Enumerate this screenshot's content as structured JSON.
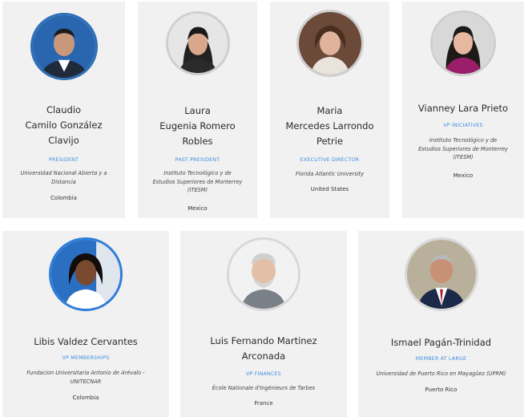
{
  "members": [
    {
      "name_lines": [
        "Claudio",
        "Camilo González",
        "Clavijo"
      ],
      "role": "PRESIDENT",
      "institution_lines": [
        "Universidad Nacional Abierta y a",
        "Distancia"
      ],
      "country": "Colombia"
    },
    {
      "name_lines": [
        "Laura",
        "Eugenia Romero",
        "Robles"
      ],
      "role": "PAST PRESIDENT",
      "institution_lines": [
        "Instituto Tecnológico y de",
        "Estudios Superiores de Monterrey",
        "(ITESM)"
      ],
      "country": "Mexico"
    },
    {
      "name_lines": [
        "Maria",
        "Mercedes Larrondo",
        "Petrie"
      ],
      "role": "EXECUTIVE DIRECTOR",
      "institution_lines": [
        "Florida Atlantic University"
      ],
      "country": "United States"
    },
    {
      "name_lines": [
        "Vianney Lara Prieto"
      ],
      "role": "VP INICIATIVES",
      "institution_lines": [
        "Instituto Tecnológico y de",
        "Estudios Superiores de Monterrey",
        "(ITESM)"
      ],
      "country": "Mexico"
    },
    {
      "name_lines": [
        "Libis Valdez Cervantes"
      ],
      "role": "VP MEMBERSHIPS",
      "institution_lines": [
        "Fundacion Universitaria Antonio de Arévalo -",
        "UNITECNAR"
      ],
      "country": "Colombia"
    },
    {
      "name_lines": [
        "Luis Fernando Martinez",
        "Arconada"
      ],
      "role": "VP FINANCES",
      "institution_lines": [
        "École Nationale d'Ingénieurs de Tarbes"
      ],
      "country": "France"
    },
    {
      "name_lines": [
        "Ismael Pagán-Trinidad"
      ],
      "role": "MEMBER AT LARGE",
      "institution_lines": [
        "Universidad de Puerto Rico en Mayagüez (UPRM)"
      ],
      "country": "Puerto Rico"
    }
  ]
}
